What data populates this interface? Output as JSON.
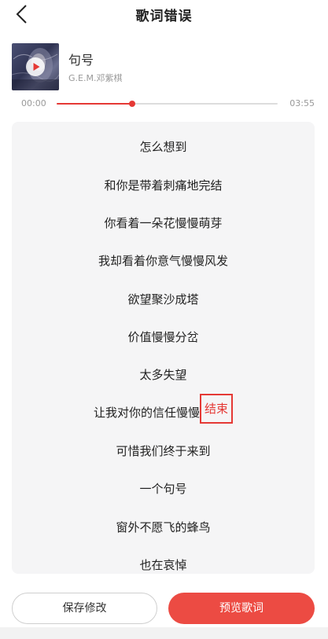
{
  "header": {
    "title": "歌词错误",
    "back_icon": "chevron-left-icon"
  },
  "song": {
    "title": "句号",
    "artist": "G.E.M.邓紫棋",
    "cover_icon": "album-cover",
    "play_icon": "play-icon"
  },
  "progress": {
    "current_time": "00:00",
    "total_time": "03:55",
    "fraction": 0.34,
    "accent_color": "#e53935"
  },
  "lyrics": {
    "lines": [
      {
        "text": "怎么想到"
      },
      {
        "text": "和你是带着刺痛地完结"
      },
      {
        "text": "你看着一朵花慢慢萌芽"
      },
      {
        "text": "我却看着你意气慢慢风发"
      },
      {
        "text": "欲望聚沙成塔"
      },
      {
        "text": "价值慢慢分岔"
      },
      {
        "text": "太多失望"
      },
      {
        "text": "让我对你的信任慢慢",
        "highlight": "结束"
      },
      {
        "text": "可惜我们终于来到"
      },
      {
        "text": "一个句号"
      },
      {
        "text": "窗外不愿飞的蜂鸟"
      },
      {
        "text": "也在哀悼"
      }
    ]
  },
  "footer": {
    "save_label": "保存修改",
    "preview_label": "预览歌词",
    "preview_color": "#ec4b43"
  }
}
